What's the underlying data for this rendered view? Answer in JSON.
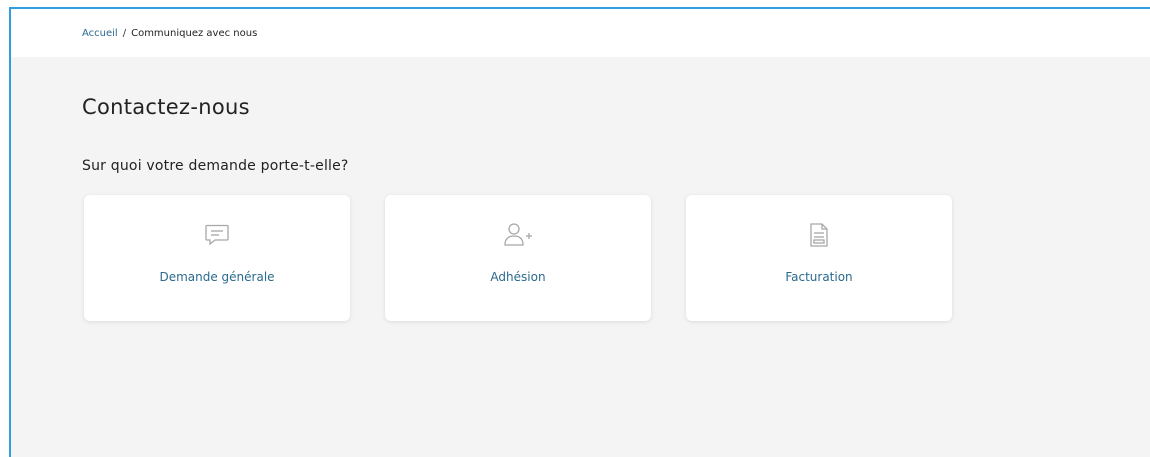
{
  "breadcrumb": {
    "home": "Accueil",
    "separator": "/",
    "current": "Communiquez avec nous"
  },
  "page": {
    "title": "Contactez-nous",
    "question": "Sur quoi votre demande porte-t-elle?"
  },
  "cards": [
    {
      "label": "Demande générale",
      "icon": "chat-icon"
    },
    {
      "label": "Adhésion",
      "icon": "add-user-icon"
    },
    {
      "label": "Facturation",
      "icon": "invoice-icon"
    }
  ],
  "colors": {
    "accent_text": "#2a6a8e",
    "frame_border": "#2f9ede",
    "background": "#f4f4f4",
    "icon_gray": "#a8a8a8"
  }
}
